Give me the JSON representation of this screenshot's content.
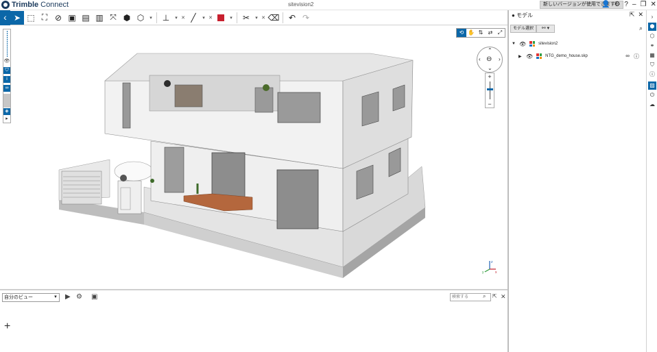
{
  "app": {
    "logo_word1": "Trimble",
    "logo_word2": "Connect",
    "document_title": "sitevision2",
    "update_notice": "新しいバージョンが使用できます！"
  },
  "toolbar": {
    "tools": [
      "select-pointer",
      "box-select",
      "fit-selection",
      "hide",
      "section-box",
      "section-plane",
      "fit-all",
      "object-explorer",
      "view-cube",
      "measure",
      "markup-line",
      "markup-color",
      "clip",
      "clear-markups",
      "undo",
      "redo"
    ],
    "markup_color": "#c8202f",
    "accent": "#0b67a8"
  },
  "viewport": {
    "nav_modes": [
      "orbit",
      "pan",
      "walk",
      "fly",
      "fullscreen"
    ],
    "active_nav_mode": "orbit",
    "zoom_in": "+",
    "zoom_out": "−",
    "axes": {
      "x": "x",
      "y": "y",
      "z": "z"
    }
  },
  "bottom_panel": {
    "view_select": "自分のビュー",
    "search_placeholder": "検索する",
    "add_label": "+"
  },
  "right_panel": {
    "title": "モデル",
    "model_select_button": "モデル選択",
    "tree": [
      {
        "label": "sitevision2",
        "expanded": true
      },
      {
        "label": "NTG_demo_house.skp",
        "expanded": false
      }
    ]
  }
}
